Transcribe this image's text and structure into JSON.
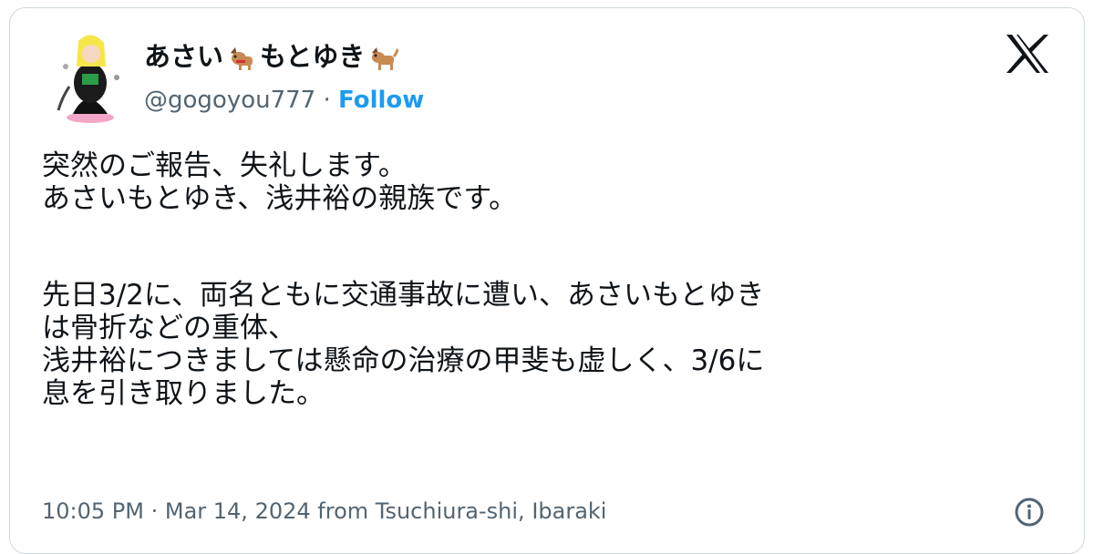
{
  "tweet": {
    "display_name_part1": "あさい",
    "display_name_part2": "もとゆき",
    "handle": "@gogoyou777",
    "separator": " · ",
    "follow_label": "Follow",
    "body_lines_1": [
      "突然のご報告、失礼します。",
      "あさいもとゆき、浅井裕の親族です。"
    ],
    "body_lines_2": [
      "先日3/2に、両名ともに交通事故に遭い、あさいもとゆき",
      "は骨折などの重体、",
      "浅井裕につきましては懸命の治療の甲斐も虚しく、3/6に",
      "息を引き取りました。"
    ],
    "timestamp": "10:05 PM · Mar 14, 2024 from Tsuchiura-shi, Ibaraki"
  },
  "icons": {
    "logo": "x-logo-icon",
    "info": "info-icon",
    "dog": "dog-emoji-icon"
  },
  "colors": {
    "accent": "#1d9bf0",
    "text": "#0f1419",
    "muted": "#536471",
    "border": "#cfd9de"
  }
}
